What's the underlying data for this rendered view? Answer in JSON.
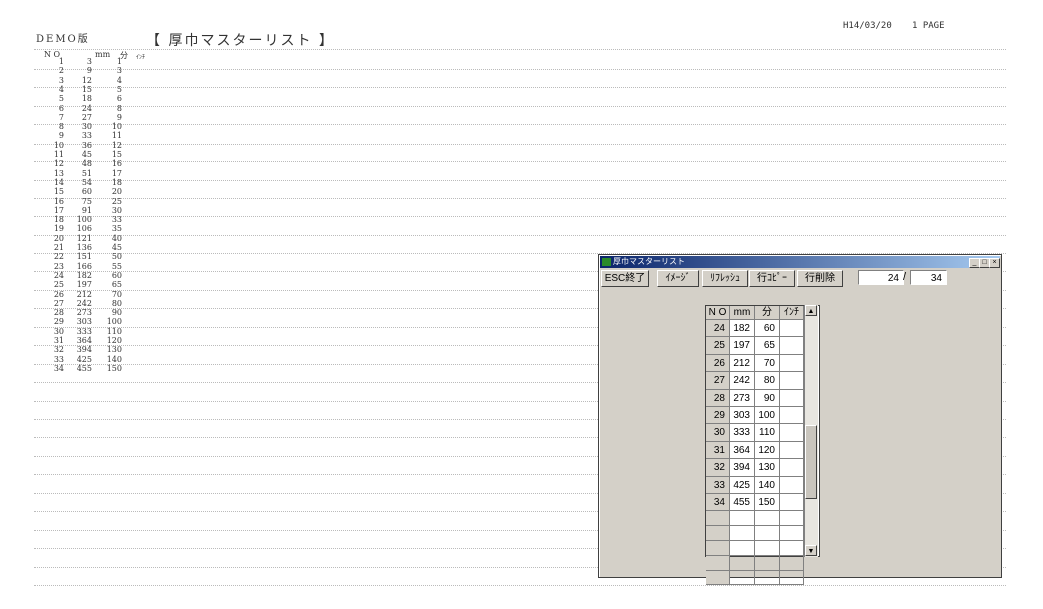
{
  "report": {
    "demo_label": "DEMO版",
    "title": "【 厚巾マスターリスト 】",
    "date": "H14/03/20",
    "page": "1 PAGE",
    "columns": [
      "N O",
      "mm",
      "分",
      "ｲﾝﾁ"
    ],
    "rows": [
      [
        "1",
        "3",
        "1"
      ],
      [
        "2",
        "9",
        "3"
      ],
      [
        "3",
        "12",
        "4"
      ],
      [
        "4",
        "15",
        "5"
      ],
      [
        "5",
        "18",
        "6"
      ],
      [
        "6",
        "24",
        "8"
      ],
      [
        "7",
        "27",
        "9"
      ],
      [
        "8",
        "30",
        "10"
      ],
      [
        "9",
        "33",
        "11"
      ],
      [
        "10",
        "36",
        "12"
      ],
      [
        "11",
        "45",
        "15"
      ],
      [
        "12",
        "48",
        "16"
      ],
      [
        "13",
        "51",
        "17"
      ],
      [
        "14",
        "54",
        "18"
      ],
      [
        "15",
        "60",
        "20"
      ],
      [
        "16",
        "75",
        "25"
      ],
      [
        "17",
        "91",
        "30"
      ],
      [
        "18",
        "100",
        "33"
      ],
      [
        "19",
        "106",
        "35"
      ],
      [
        "20",
        "121",
        "40"
      ],
      [
        "21",
        "136",
        "45"
      ],
      [
        "22",
        "151",
        "50"
      ],
      [
        "23",
        "166",
        "55"
      ],
      [
        "24",
        "182",
        "60"
      ],
      [
        "25",
        "197",
        "65"
      ],
      [
        "26",
        "212",
        "70"
      ],
      [
        "27",
        "242",
        "80"
      ],
      [
        "28",
        "273",
        "90"
      ],
      [
        "29",
        "303",
        "100"
      ],
      [
        "30",
        "333",
        "110"
      ],
      [
        "31",
        "364",
        "120"
      ],
      [
        "32",
        "394",
        "130"
      ],
      [
        "33",
        "425",
        "140"
      ],
      [
        "34",
        "455",
        "150"
      ]
    ]
  },
  "window": {
    "title": "厚巾マスターリスト",
    "buttons": {
      "esc": "ESC終了",
      "image": "ｲﾒｰｼﾞ",
      "refresh": "ﾘﾌﾚｯｼｭ",
      "copy": "行ｺﾋﾟｰ",
      "delete": "行削除"
    },
    "page_current": "24",
    "page_total": "34",
    "grid_columns": [
      "N O",
      "mm",
      "分",
      "ｲﾝﾁ"
    ],
    "grid_rows": [
      [
        "24",
        "182",
        "60",
        ""
      ],
      [
        "25",
        "197",
        "65",
        ""
      ],
      [
        "26",
        "212",
        "70",
        ""
      ],
      [
        "27",
        "242",
        "80",
        ""
      ],
      [
        "28",
        "273",
        "90",
        ""
      ],
      [
        "29",
        "303",
        "100",
        ""
      ],
      [
        "30",
        "333",
        "110",
        ""
      ],
      [
        "31",
        "364",
        "120",
        ""
      ],
      [
        "32",
        "394",
        "130",
        ""
      ],
      [
        "33",
        "425",
        "140",
        ""
      ],
      [
        "34",
        "455",
        "150",
        ""
      ]
    ],
    "empty_rows": 5
  }
}
